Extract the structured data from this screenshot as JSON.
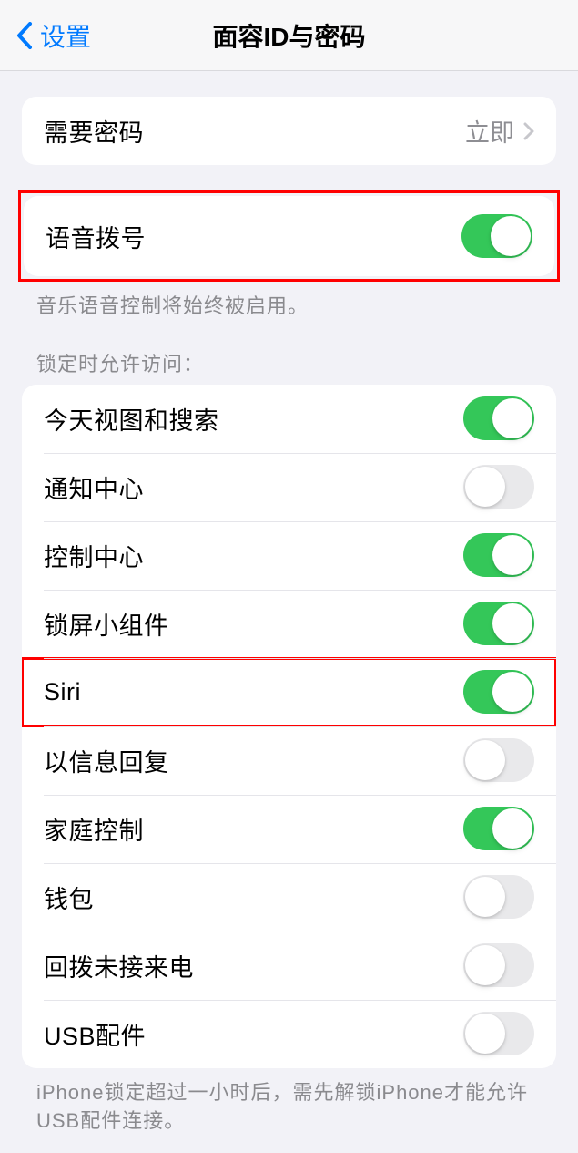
{
  "header": {
    "back_label": "设置",
    "title": "面容ID与密码"
  },
  "passcode_group": {
    "require_label": "需要密码",
    "require_value": "立即"
  },
  "voice_dial": {
    "label": "语音拨号",
    "footer": "音乐语音控制将始终被启用。",
    "on": true
  },
  "lock_header": "锁定时允许访问：",
  "lock_items": [
    {
      "label": "今天视图和搜索",
      "on": true
    },
    {
      "label": "通知中心",
      "on": false
    },
    {
      "label": "控制中心",
      "on": true
    },
    {
      "label": "锁屏小组件",
      "on": true
    },
    {
      "label": "Siri",
      "on": true,
      "highlight": true
    },
    {
      "label": "以信息回复",
      "on": false
    },
    {
      "label": "家庭控制",
      "on": true
    },
    {
      "label": "钱包",
      "on": false
    },
    {
      "label": "回拨未接来电",
      "on": false
    },
    {
      "label": "USB配件",
      "on": false
    }
  ],
  "usb_footer": "iPhone锁定超过一小时后，需先解锁iPhone才能允许USB配件连接。"
}
